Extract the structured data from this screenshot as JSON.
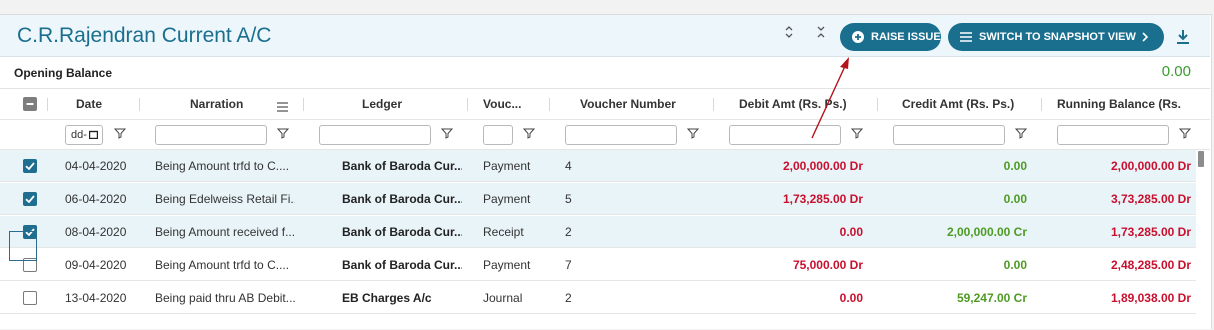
{
  "header": {
    "title": "C.R.Rajendran Current A/C",
    "expand_icon": "chevron-up-down-icon",
    "collapse_icon": "chevrons-collapse-icon",
    "raise_issue_label": "RAISE ISSUE",
    "snapshot_label": "SWITCH TO SNAPSHOT VIEW",
    "download_icon": "download-icon"
  },
  "opening_balance": {
    "label": "Opening Balance",
    "value": "0.00"
  },
  "columns": [
    "Date",
    "Narration",
    "Ledger",
    "Vouc...",
    "Voucher Number",
    "Debit Amt (Rs. Ps.)",
    "Credit Amt (Rs. Ps.)",
    "Running Balance (Rs..."
  ],
  "filters": {
    "date_placeholder": "dd-"
  },
  "rows": [
    {
      "checked": true,
      "date": "04-04-2020",
      "narration": "Being Amount trfd to C....",
      "ledger": "Bank of Baroda Cur...",
      "voucher": "Payment",
      "voucher_no": "4",
      "debit": "2,00,000.00 Dr",
      "credit": "0.00",
      "balance": "2,00,000.00 Dr"
    },
    {
      "checked": true,
      "date": "06-04-2020",
      "narration": "Being Edelweiss Retail Fi...",
      "ledger": "Bank of Baroda Cur...",
      "voucher": "Payment",
      "voucher_no": "5",
      "debit": "1,73,285.00 Dr",
      "credit": "0.00",
      "balance": "3,73,285.00 Dr"
    },
    {
      "checked": true,
      "date": "08-04-2020",
      "narration": "Being Amount received f...",
      "ledger": "Bank of Baroda Cur...",
      "voucher": "Receipt",
      "voucher_no": "2",
      "debit": "0.00",
      "credit": "2,00,000.00 Cr",
      "balance": "1,73,285.00 Dr"
    },
    {
      "checked": false,
      "date": "09-04-2020",
      "narration": "Being Amount trfd to C....",
      "ledger": "Bank of Baroda Cur...",
      "voucher": "Payment",
      "voucher_no": "7",
      "debit": "75,000.00 Dr",
      "credit": "0.00",
      "balance": "2,48,285.00 Dr"
    },
    {
      "checked": false,
      "date": "13-04-2020",
      "narration": "Being paid thru AB Debit...",
      "ledger": "EB Charges A/c",
      "voucher": "Journal",
      "voucher_no": "2",
      "debit": "0.00",
      "credit": "59,247.00 Cr",
      "balance": "1,89,038.00 Dr"
    }
  ],
  "colors": {
    "accent": "#1a6f8f",
    "debit": "#c8102e",
    "credit": "#4f9a23",
    "annotation": "#b5121b"
  }
}
